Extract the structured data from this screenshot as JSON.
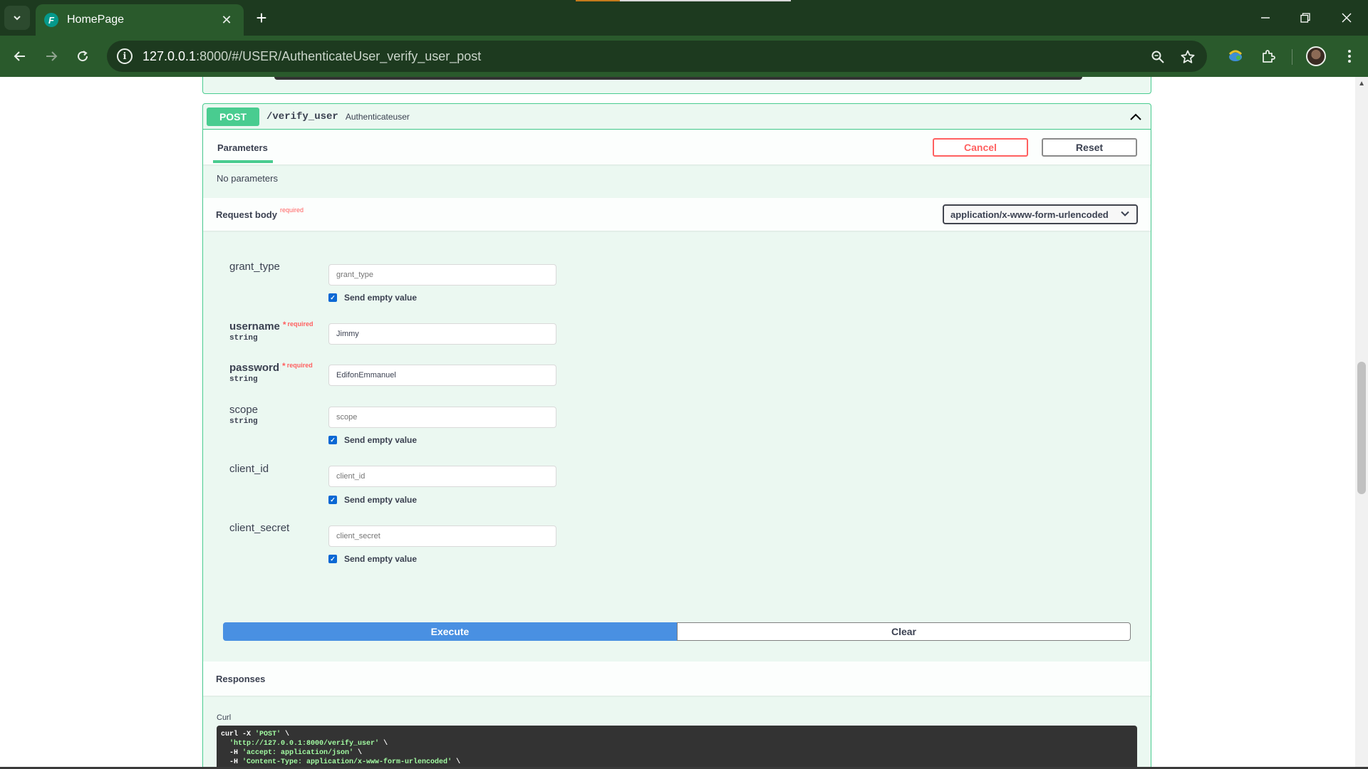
{
  "browser": {
    "tab_title": "HomePage",
    "tab_favicon": "F",
    "new_tab": "+",
    "close_tab": "✕",
    "url_host": "127.0.0.1",
    "url_rest": ":8000/#/USER/AuthenticateUser_verify_user_post",
    "icons": [
      "tab-search-icon",
      "back-icon",
      "forward-icon",
      "reload-icon",
      "site-info-icon",
      "zoom-icon",
      "bookmark-star-icon",
      "extension-icon",
      "puzzle-icon",
      "avatar",
      "menu-icon",
      "minimize-icon",
      "restore-icon",
      "close-window-icon"
    ]
  },
  "operation": {
    "method": "POST",
    "path": "/verify_user",
    "description": "Authenticateuser"
  },
  "parameters": {
    "tab_label": "Parameters",
    "cancel_label": "Cancel",
    "reset_label": "Reset",
    "empty_text": "No parameters"
  },
  "request_body": {
    "title": "Request body",
    "required_label": "required",
    "content_type": "application/x-www-form-urlencoded"
  },
  "fields": {
    "grant_type": {
      "name": "grant_type",
      "type": "",
      "placeholder": "grant_type",
      "value": "",
      "send_empty": "Send empty value"
    },
    "username": {
      "name": "username",
      "star": "*",
      "required": "required",
      "type": "string",
      "value": "Jimmy"
    },
    "password": {
      "name": "password",
      "star": "*",
      "required": "required",
      "type": "string",
      "value": "EdifonEmmanuel"
    },
    "scope": {
      "name": "scope",
      "type": "string",
      "placeholder": "scope",
      "send_empty": "Send empty value"
    },
    "client_id": {
      "name": "client_id",
      "placeholder": "client_id",
      "send_empty": "Send empty value"
    },
    "client_secret": {
      "name": "client_secret",
      "placeholder": "client_secret",
      "send_empty": "Send empty value"
    }
  },
  "actions": {
    "execute_label": "Execute",
    "clear_label": "Clear"
  },
  "responses": {
    "title": "Responses",
    "curl_label": "Curl",
    "curl_line1_cmd": "curl -X ",
    "curl_line1_str": "'POST'",
    "curl_line1_end": " \\",
    "curl_line2_str": "'http://127.0.0.1:8000/verify_user'",
    "curl_line2_end": " \\",
    "curl_line3_cmd": "  -H ",
    "curl_line3_str": "'accept: application/json'",
    "curl_line3_end": " \\",
    "curl_line4_cmd": "  -H ",
    "curl_line4_str": "'Content-Type: application/x-www-form-urlencoded'",
    "curl_line4_end": " \\"
  },
  "colors": {
    "post_green": "#49cc90",
    "execute_blue": "#4990e2",
    "cancel_red": "#ff6060",
    "browser_dark": "#1d3a1f",
    "browser_toolbar": "#2a5a2c"
  }
}
